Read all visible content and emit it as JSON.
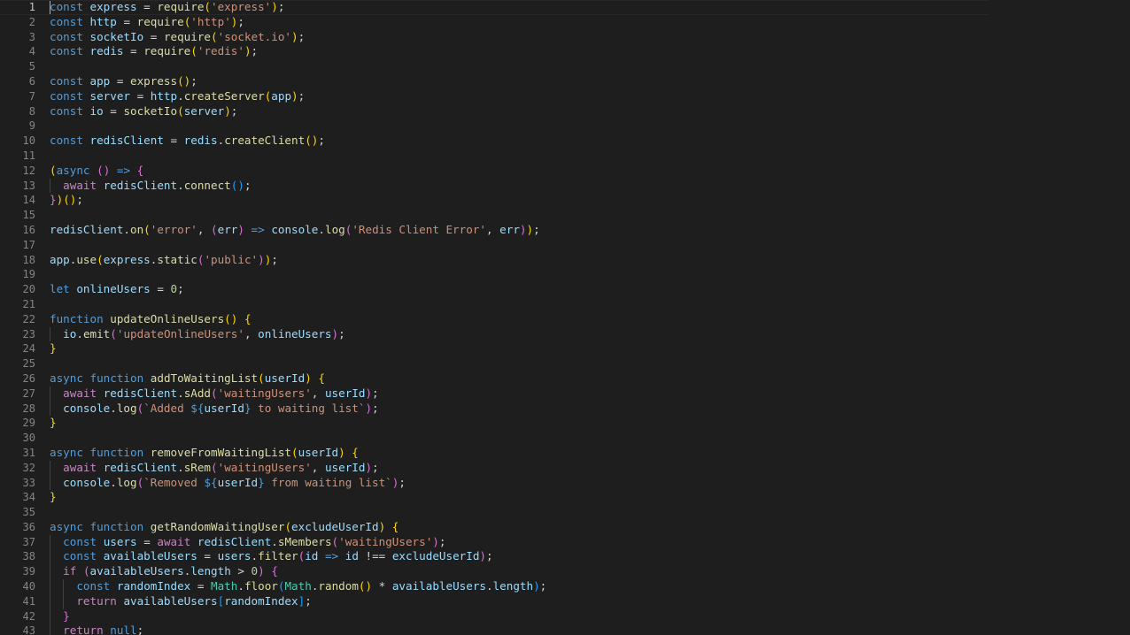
{
  "editor": {
    "active_line": 1,
    "line_numbers": [
      "1",
      "2",
      "3",
      "4",
      "5",
      "6",
      "7",
      "8",
      "9",
      "10",
      "11",
      "12",
      "13",
      "14",
      "15",
      "16",
      "17",
      "18",
      "19",
      "20",
      "21",
      "22",
      "23",
      "24",
      "25",
      "26",
      "27",
      "28",
      "29",
      "30",
      "31",
      "32",
      "33",
      "34",
      "35",
      "36",
      "37",
      "38",
      "39",
      "40",
      "41",
      "42",
      "43"
    ],
    "lines": [
      [
        [
          "kw",
          "const"
        ],
        [
          "pl",
          " "
        ],
        [
          "var",
          "express"
        ],
        [
          "pl",
          " = "
        ],
        [
          "fn",
          "require"
        ],
        [
          "p1",
          "("
        ],
        [
          "str",
          "'express'"
        ],
        [
          "p1",
          ")"
        ],
        [
          "pl",
          ";"
        ]
      ],
      [
        [
          "kw",
          "const"
        ],
        [
          "pl",
          " "
        ],
        [
          "var",
          "http"
        ],
        [
          "pl",
          " = "
        ],
        [
          "fn",
          "require"
        ],
        [
          "p1",
          "("
        ],
        [
          "str",
          "'http'"
        ],
        [
          "p1",
          ")"
        ],
        [
          "pl",
          ";"
        ]
      ],
      [
        [
          "kw",
          "const"
        ],
        [
          "pl",
          " "
        ],
        [
          "var",
          "socketIo"
        ],
        [
          "pl",
          " = "
        ],
        [
          "fn",
          "require"
        ],
        [
          "p1",
          "("
        ],
        [
          "str",
          "'socket.io'"
        ],
        [
          "p1",
          ")"
        ],
        [
          "pl",
          ";"
        ]
      ],
      [
        [
          "kw",
          "const"
        ],
        [
          "pl",
          " "
        ],
        [
          "var",
          "redis"
        ],
        [
          "pl",
          " = "
        ],
        [
          "fn",
          "require"
        ],
        [
          "p1",
          "("
        ],
        [
          "str",
          "'redis'"
        ],
        [
          "p1",
          ")"
        ],
        [
          "pl",
          ";"
        ]
      ],
      [],
      [
        [
          "kw",
          "const"
        ],
        [
          "pl",
          " "
        ],
        [
          "var",
          "app"
        ],
        [
          "pl",
          " = "
        ],
        [
          "fn",
          "express"
        ],
        [
          "p1",
          "()"
        ],
        [
          "pl",
          ";"
        ]
      ],
      [
        [
          "kw",
          "const"
        ],
        [
          "pl",
          " "
        ],
        [
          "var",
          "server"
        ],
        [
          "pl",
          " = "
        ],
        [
          "var",
          "http"
        ],
        [
          "pl",
          "."
        ],
        [
          "fn",
          "createServer"
        ],
        [
          "p1",
          "("
        ],
        [
          "var",
          "app"
        ],
        [
          "p1",
          ")"
        ],
        [
          "pl",
          ";"
        ]
      ],
      [
        [
          "kw",
          "const"
        ],
        [
          "pl",
          " "
        ],
        [
          "var",
          "io"
        ],
        [
          "pl",
          " = "
        ],
        [
          "fn",
          "socketIo"
        ],
        [
          "p1",
          "("
        ],
        [
          "var",
          "server"
        ],
        [
          "p1",
          ")"
        ],
        [
          "pl",
          ";"
        ]
      ],
      [],
      [
        [
          "kw",
          "const"
        ],
        [
          "pl",
          " "
        ],
        [
          "var",
          "redisClient"
        ],
        [
          "pl",
          " = "
        ],
        [
          "var",
          "redis"
        ],
        [
          "pl",
          "."
        ],
        [
          "fn",
          "createClient"
        ],
        [
          "p1",
          "()"
        ],
        [
          "pl",
          ";"
        ]
      ],
      [],
      [
        [
          "p1",
          "("
        ],
        [
          "kw",
          "async"
        ],
        [
          "pl",
          " "
        ],
        [
          "p2",
          "()"
        ],
        [
          "pl",
          " "
        ],
        [
          "kw",
          "=>"
        ],
        [
          "pl",
          " "
        ],
        [
          "p2",
          "{"
        ]
      ],
      [
        [
          "pl",
          "  "
        ],
        [
          "ctl",
          "await"
        ],
        [
          "pl",
          " "
        ],
        [
          "var",
          "redisClient"
        ],
        [
          "pl",
          "."
        ],
        [
          "fn",
          "connect"
        ],
        [
          "p3",
          "()"
        ],
        [
          "pl",
          ";"
        ]
      ],
      [
        [
          "p2",
          "}"
        ],
        [
          "p1",
          ")"
        ],
        [
          "p1",
          "()"
        ],
        [
          "pl",
          ";"
        ]
      ],
      [],
      [
        [
          "var",
          "redisClient"
        ],
        [
          "pl",
          "."
        ],
        [
          "fn",
          "on"
        ],
        [
          "p1",
          "("
        ],
        [
          "str",
          "'error'"
        ],
        [
          "pl",
          ", "
        ],
        [
          "p2",
          "("
        ],
        [
          "var",
          "err"
        ],
        [
          "p2",
          ")"
        ],
        [
          "pl",
          " "
        ],
        [
          "kw",
          "=>"
        ],
        [
          "pl",
          " "
        ],
        [
          "var",
          "console"
        ],
        [
          "pl",
          "."
        ],
        [
          "fn",
          "log"
        ],
        [
          "p2",
          "("
        ],
        [
          "str",
          "'Redis Client Error'"
        ],
        [
          "pl",
          ", "
        ],
        [
          "var",
          "err"
        ],
        [
          "p2",
          ")"
        ],
        [
          "p1",
          ")"
        ],
        [
          "pl",
          ";"
        ]
      ],
      [],
      [
        [
          "var",
          "app"
        ],
        [
          "pl",
          "."
        ],
        [
          "fn",
          "use"
        ],
        [
          "p1",
          "("
        ],
        [
          "var",
          "express"
        ],
        [
          "pl",
          "."
        ],
        [
          "fn",
          "static"
        ],
        [
          "p2",
          "("
        ],
        [
          "str",
          "'public'"
        ],
        [
          "p2",
          ")"
        ],
        [
          "p1",
          ")"
        ],
        [
          "pl",
          ";"
        ]
      ],
      [],
      [
        [
          "kw",
          "let"
        ],
        [
          "pl",
          " "
        ],
        [
          "var",
          "onlineUsers"
        ],
        [
          "pl",
          " = "
        ],
        [
          "num",
          "0"
        ],
        [
          "pl",
          ";"
        ]
      ],
      [],
      [
        [
          "kw",
          "function"
        ],
        [
          "pl",
          " "
        ],
        [
          "fn",
          "updateOnlineUsers"
        ],
        [
          "p1",
          "()"
        ],
        [
          "pl",
          " "
        ],
        [
          "p1",
          "{"
        ]
      ],
      [
        [
          "pl",
          "  "
        ],
        [
          "var",
          "io"
        ],
        [
          "pl",
          "."
        ],
        [
          "fn",
          "emit"
        ],
        [
          "p2",
          "("
        ],
        [
          "str",
          "'updateOnlineUsers'"
        ],
        [
          "pl",
          ", "
        ],
        [
          "var",
          "onlineUsers"
        ],
        [
          "p2",
          ")"
        ],
        [
          "pl",
          ";"
        ]
      ],
      [
        [
          "p1",
          "}"
        ]
      ],
      [],
      [
        [
          "kw",
          "async"
        ],
        [
          "pl",
          " "
        ],
        [
          "kw",
          "function"
        ],
        [
          "pl",
          " "
        ],
        [
          "fn",
          "addToWaitingList"
        ],
        [
          "p1",
          "("
        ],
        [
          "var",
          "userId"
        ],
        [
          "p1",
          ")"
        ],
        [
          "pl",
          " "
        ],
        [
          "p1",
          "{"
        ]
      ],
      [
        [
          "pl",
          "  "
        ],
        [
          "ctl",
          "await"
        ],
        [
          "pl",
          " "
        ],
        [
          "var",
          "redisClient"
        ],
        [
          "pl",
          "."
        ],
        [
          "fn",
          "sAdd"
        ],
        [
          "p2",
          "("
        ],
        [
          "str",
          "'waitingUsers'"
        ],
        [
          "pl",
          ", "
        ],
        [
          "var",
          "userId"
        ],
        [
          "p2",
          ")"
        ],
        [
          "pl",
          ";"
        ]
      ],
      [
        [
          "pl",
          "  "
        ],
        [
          "var",
          "console"
        ],
        [
          "pl",
          "."
        ],
        [
          "fn",
          "log"
        ],
        [
          "p2",
          "("
        ],
        [
          "str",
          "`Added "
        ],
        [
          "kw",
          "${"
        ],
        [
          "var",
          "userId"
        ],
        [
          "kw",
          "}"
        ],
        [
          "str",
          " to waiting list`"
        ],
        [
          "p2",
          ")"
        ],
        [
          "pl",
          ";"
        ]
      ],
      [
        [
          "p1",
          "}"
        ]
      ],
      [],
      [
        [
          "kw",
          "async"
        ],
        [
          "pl",
          " "
        ],
        [
          "kw",
          "function"
        ],
        [
          "pl",
          " "
        ],
        [
          "fn",
          "removeFromWaitingList"
        ],
        [
          "p1",
          "("
        ],
        [
          "var",
          "userId"
        ],
        [
          "p1",
          ")"
        ],
        [
          "pl",
          " "
        ],
        [
          "p1",
          "{"
        ]
      ],
      [
        [
          "pl",
          "  "
        ],
        [
          "ctl",
          "await"
        ],
        [
          "pl",
          " "
        ],
        [
          "var",
          "redisClient"
        ],
        [
          "pl",
          "."
        ],
        [
          "fn",
          "sRem"
        ],
        [
          "p2",
          "("
        ],
        [
          "str",
          "'waitingUsers'"
        ],
        [
          "pl",
          ", "
        ],
        [
          "var",
          "userId"
        ],
        [
          "p2",
          ")"
        ],
        [
          "pl",
          ";"
        ]
      ],
      [
        [
          "pl",
          "  "
        ],
        [
          "var",
          "console"
        ],
        [
          "pl",
          "."
        ],
        [
          "fn",
          "log"
        ],
        [
          "p2",
          "("
        ],
        [
          "str",
          "`Removed "
        ],
        [
          "kw",
          "${"
        ],
        [
          "var",
          "userId"
        ],
        [
          "kw",
          "}"
        ],
        [
          "str",
          " from waiting list`"
        ],
        [
          "p2",
          ")"
        ],
        [
          "pl",
          ";"
        ]
      ],
      [
        [
          "p1",
          "}"
        ]
      ],
      [],
      [
        [
          "kw",
          "async"
        ],
        [
          "pl",
          " "
        ],
        [
          "kw",
          "function"
        ],
        [
          "pl",
          " "
        ],
        [
          "fn",
          "getRandomWaitingUser"
        ],
        [
          "p1",
          "("
        ],
        [
          "var",
          "excludeUserId"
        ],
        [
          "p1",
          ")"
        ],
        [
          "pl",
          " "
        ],
        [
          "p1",
          "{"
        ]
      ],
      [
        [
          "pl",
          "  "
        ],
        [
          "kw",
          "const"
        ],
        [
          "pl",
          " "
        ],
        [
          "var",
          "users"
        ],
        [
          "pl",
          " = "
        ],
        [
          "ctl",
          "await"
        ],
        [
          "pl",
          " "
        ],
        [
          "var",
          "redisClient"
        ],
        [
          "pl",
          "."
        ],
        [
          "fn",
          "sMembers"
        ],
        [
          "p2",
          "("
        ],
        [
          "str",
          "'waitingUsers'"
        ],
        [
          "p2",
          ")"
        ],
        [
          "pl",
          ";"
        ]
      ],
      [
        [
          "pl",
          "  "
        ],
        [
          "kw",
          "const"
        ],
        [
          "pl",
          " "
        ],
        [
          "var",
          "availableUsers"
        ],
        [
          "pl",
          " = "
        ],
        [
          "var",
          "users"
        ],
        [
          "pl",
          "."
        ],
        [
          "fn",
          "filter"
        ],
        [
          "p2",
          "("
        ],
        [
          "var",
          "id"
        ],
        [
          "pl",
          " "
        ],
        [
          "kw",
          "=>"
        ],
        [
          "pl",
          " "
        ],
        [
          "var",
          "id"
        ],
        [
          "pl",
          " !== "
        ],
        [
          "var",
          "excludeUserId"
        ],
        [
          "p2",
          ")"
        ],
        [
          "pl",
          ";"
        ]
      ],
      [
        [
          "pl",
          "  "
        ],
        [
          "ctl",
          "if"
        ],
        [
          "pl",
          " "
        ],
        [
          "p2",
          "("
        ],
        [
          "var",
          "availableUsers"
        ],
        [
          "pl",
          "."
        ],
        [
          "var",
          "length"
        ],
        [
          "pl",
          " > "
        ],
        [
          "num",
          "0"
        ],
        [
          "p2",
          ")"
        ],
        [
          "pl",
          " "
        ],
        [
          "p2",
          "{"
        ]
      ],
      [
        [
          "pl",
          "    "
        ],
        [
          "kw",
          "const"
        ],
        [
          "pl",
          " "
        ],
        [
          "var",
          "randomIndex"
        ],
        [
          "pl",
          " = "
        ],
        [
          "cls",
          "Math"
        ],
        [
          "pl",
          "."
        ],
        [
          "fn",
          "floor"
        ],
        [
          "p3",
          "("
        ],
        [
          "cls",
          "Math"
        ],
        [
          "pl",
          "."
        ],
        [
          "fn",
          "random"
        ],
        [
          "p1",
          "()"
        ],
        [
          "pl",
          " * "
        ],
        [
          "var",
          "availableUsers"
        ],
        [
          "pl",
          "."
        ],
        [
          "var",
          "length"
        ],
        [
          "p3",
          ")"
        ],
        [
          "pl",
          ";"
        ]
      ],
      [
        [
          "pl",
          "    "
        ],
        [
          "ctl",
          "return"
        ],
        [
          "pl",
          " "
        ],
        [
          "var",
          "availableUsers"
        ],
        [
          "p3",
          "["
        ],
        [
          "var",
          "randomIndex"
        ],
        [
          "p3",
          "]"
        ],
        [
          "pl",
          ";"
        ]
      ],
      [
        [
          "pl",
          "  "
        ],
        [
          "p2",
          "}"
        ]
      ],
      [
        [
          "pl",
          "  "
        ],
        [
          "ctl",
          "return"
        ],
        [
          "pl",
          " "
        ],
        [
          "kw",
          "null"
        ],
        [
          "pl",
          ";"
        ]
      ]
    ]
  }
}
